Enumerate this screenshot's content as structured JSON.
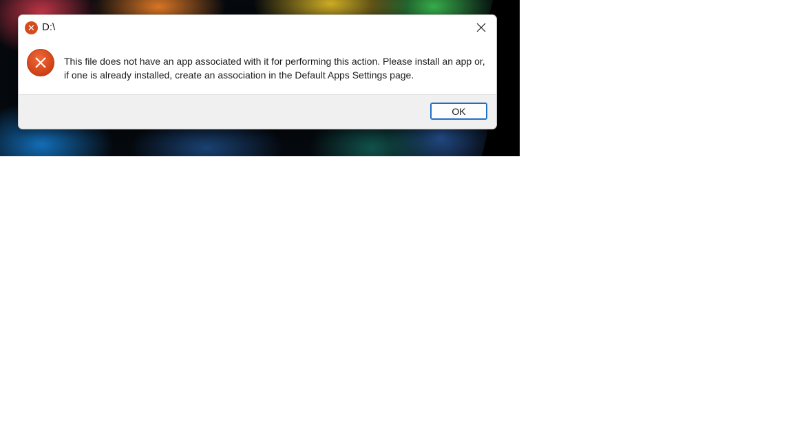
{
  "dialog": {
    "title": "D:\\",
    "message": "This file does not have an app associated with it for performing this action. Please install an app or, if one is already installed, create an association in the Default Apps Settings page.",
    "ok_label": "OK",
    "icons": {
      "title": "error-icon",
      "message": "error-icon",
      "close": "close-icon"
    }
  },
  "colors": {
    "error_red": "#d64a1d",
    "button_border": "#1f6fc4",
    "footer_bg": "#f0f0f0"
  }
}
